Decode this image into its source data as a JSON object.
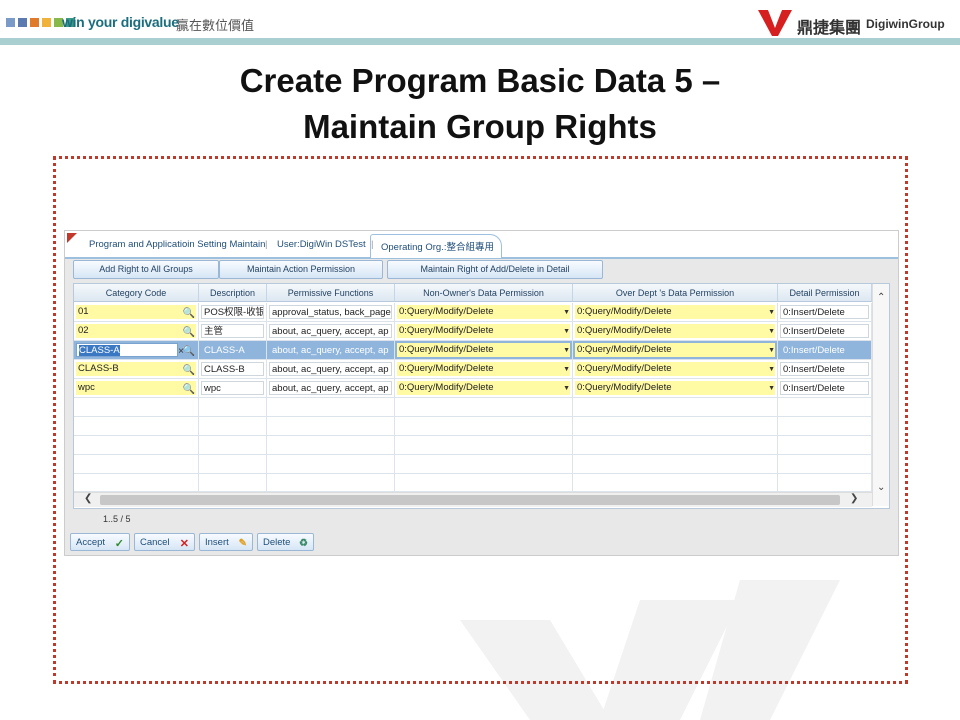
{
  "header": {
    "slogan": "win your digivalue",
    "slogan_cn": "贏在數位價值",
    "logo_cn": "鼎捷集團",
    "logo_en": "DigiwinGroup",
    "square_colors": [
      "#7a9ac7",
      "#5a7ab0",
      "#e07b2c",
      "#f0b23a",
      "#86b84a",
      "#3a9a8a"
    ]
  },
  "slide": {
    "title_line1": "Create Program Basic Data 5 –",
    "title_line2": "Maintain Group Rights"
  },
  "app": {
    "tabs": [
      {
        "label": "Program and Applicatioin Setting Maintain"
      },
      {
        "label": "User:DigiWin DSTest"
      },
      {
        "label": "Operating Org.:整合組專用"
      }
    ],
    "toolbar": {
      "add_right_all": "Add Right to All Groups",
      "maintain_action": "Maintain Action Permission",
      "maintain_add_delete": "Maintain Right of Add/Delete in Detail"
    },
    "grid": {
      "columns": [
        "Category Code",
        "Description",
        "Permissive Functions",
        "Non-Owner's Data Permission",
        "Over Dept 's Data Permission",
        "Detail Permission"
      ],
      "rows": [
        {
          "code": "01",
          "description": "POS权限-收银",
          "functions": "approval_status, back_page",
          "non_owner": "0:Query/Modify/Delete",
          "over_dept": "0:Query/Modify/Delete",
          "detail": "0:Insert/Delete"
        },
        {
          "code": "02",
          "description": "主管",
          "functions": "about, ac_query, accept, ap",
          "non_owner": "0:Query/Modify/Delete",
          "over_dept": "0:Query/Modify/Delete",
          "detail": "0:Insert/Delete"
        },
        {
          "code": "CLASS-A",
          "description": "CLASS-A",
          "functions": "about, ac_query, accept, ap",
          "non_owner": "0:Query/Modify/Delete",
          "over_dept": "0:Query/Modify/Delete",
          "detail": "0:Insert/Delete"
        },
        {
          "code": "CLASS-B",
          "description": "CLASS-B",
          "functions": "about, ac_query, accept, ap",
          "non_owner": "0:Query/Modify/Delete",
          "over_dept": "0:Query/Modify/Delete",
          "detail": "0:Insert/Delete"
        },
        {
          "code": "wpc",
          "description": "wpc",
          "functions": "about, ac_query, accept, ap",
          "non_owner": "0:Query/Modify/Delete",
          "over_dept": "0:Query/Modify/Delete",
          "detail": "0:Insert/Delete"
        }
      ],
      "selected_row": 2
    },
    "pager": "1..5 / 5",
    "actions": {
      "accept": "Accept",
      "cancel": "Cancel",
      "insert": "Insert",
      "delete": "Delete"
    }
  }
}
